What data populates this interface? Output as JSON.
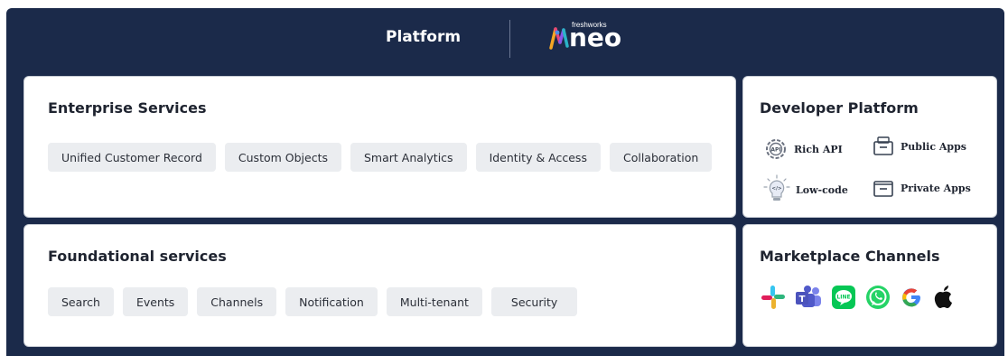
{
  "header": {
    "title": "Platform",
    "logo_small": "freshworks",
    "logo_word": "neo"
  },
  "enterprise": {
    "title": "Enterprise Services",
    "chips": [
      "Unified Customer Record",
      "Custom Objects",
      "Smart Analytics",
      "Identity & Access",
      "Collaboration"
    ]
  },
  "foundational": {
    "title": "Foundational services",
    "chips": [
      "Search",
      "Events",
      "Channels",
      "Notification",
      "Multi-tenant",
      "Security"
    ]
  },
  "developer": {
    "title": "Developer Platform",
    "items": [
      {
        "label": "Rich API",
        "icon": "api-gear-icon"
      },
      {
        "label": "Public Apps",
        "icon": "public-apps-icon"
      },
      {
        "label": "Low-code",
        "icon": "lightbulb-icon"
      },
      {
        "label": "Private Apps",
        "icon": "private-apps-icon"
      }
    ]
  },
  "marketplace": {
    "title": "Marketplace Channels",
    "channels": [
      "slack-icon",
      "teams-icon",
      "line-icon",
      "whatsapp-icon",
      "google-icon",
      "apple-icon"
    ]
  },
  "colors": {
    "frame": "#1b2a4a",
    "chip": "#ebedf0",
    "card_border": "#c7ccd4"
  }
}
